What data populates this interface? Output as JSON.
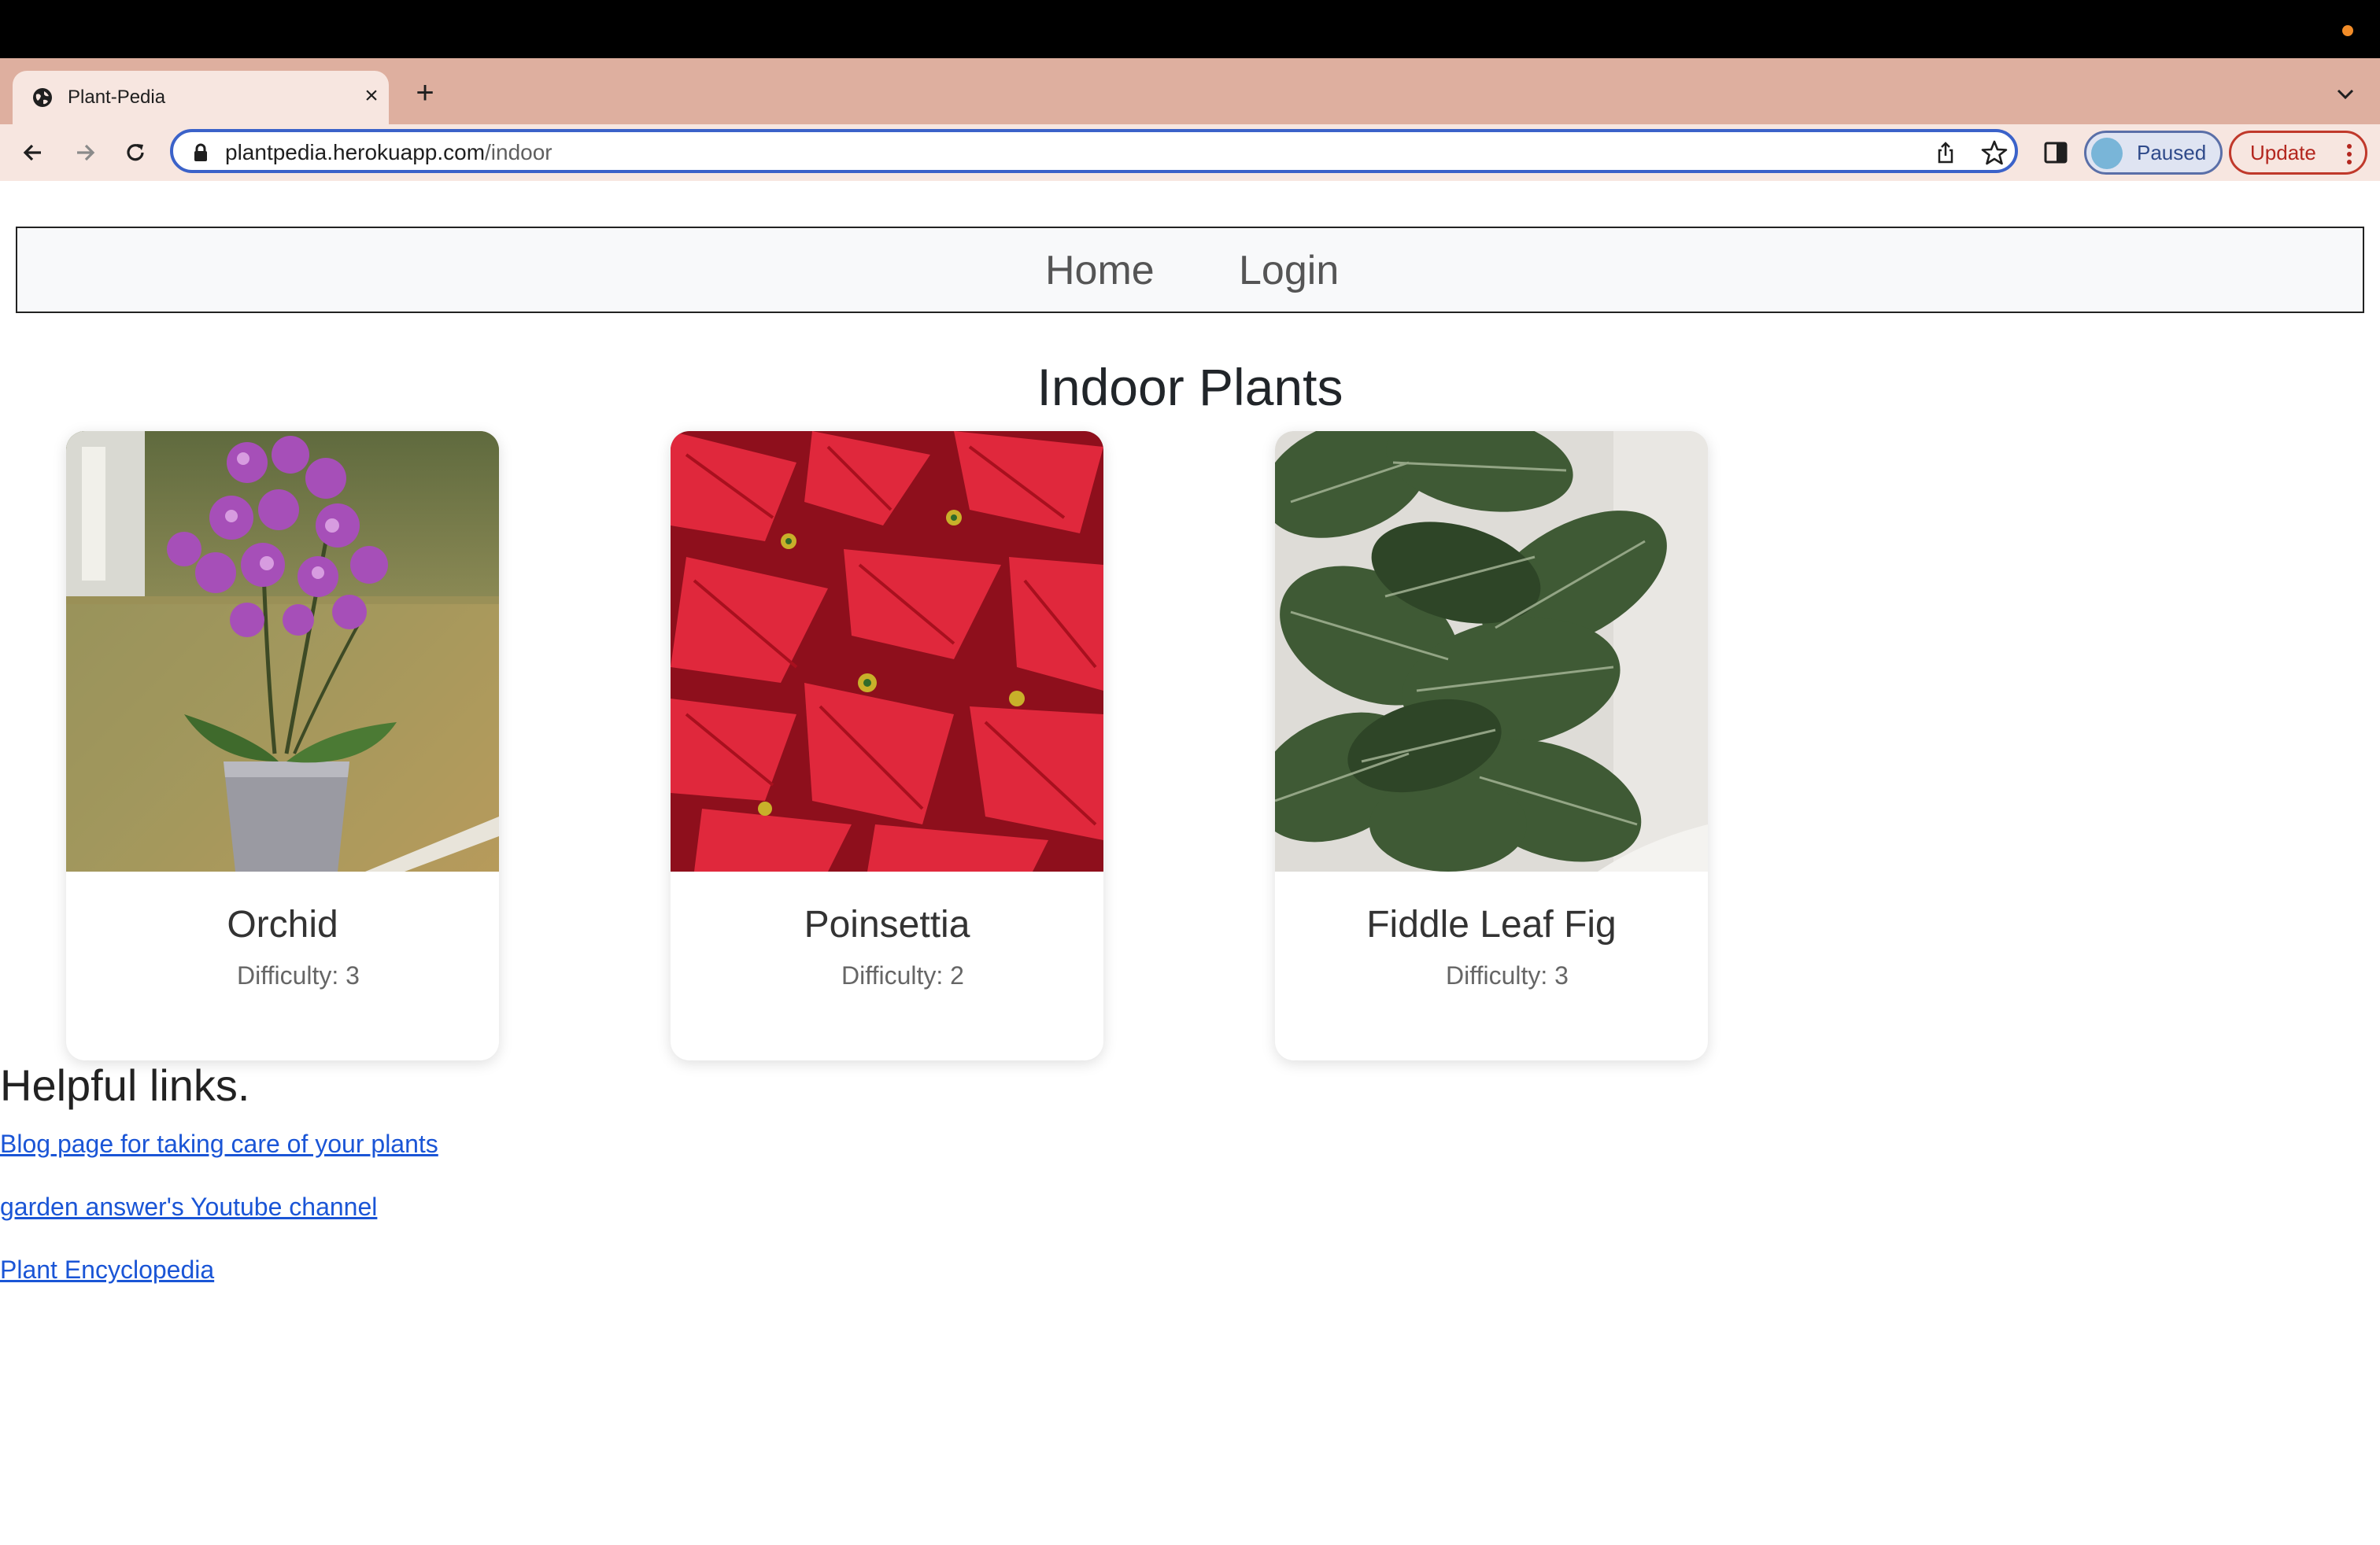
{
  "browser": {
    "tab_title": "Plant-Pedia",
    "new_tab_symbol": "+",
    "close_symbol": "×",
    "url_host": "plantpedia.herokuapp.com",
    "url_path": "/indoor",
    "profile_label": "Paused",
    "update_label": "Update"
  },
  "nav": {
    "home": "Home",
    "login": "Login"
  },
  "main": {
    "title": "Indoor Plants",
    "cards": [
      {
        "name": "Orchid",
        "difficulty": "Difficulty: 3",
        "image": "orchid-photo"
      },
      {
        "name": "Poinsettia",
        "difficulty": "Difficulty: 2",
        "image": "poinsettia-photo"
      },
      {
        "name": "Fiddle Leaf Fig",
        "difficulty": "Difficulty: 3",
        "image": "fiddle-leaf-fig-photo"
      }
    ]
  },
  "helpful": {
    "heading": "Helpful links.",
    "links": [
      "Blog page for taking care of your plants",
      "garden answer's Youtube channel",
      "Plant Encyclopedia"
    ]
  },
  "colors": {
    "tab_strip": "#deaf9f",
    "toolbar": "#f7e6e0",
    "omnibox_focus": "#3b62c9",
    "link": "#1a55d6"
  }
}
